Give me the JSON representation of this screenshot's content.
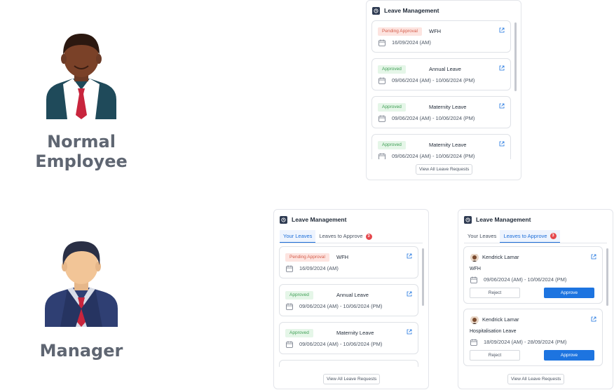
{
  "personas": {
    "employee": {
      "label": "Normal Employee"
    },
    "manager": {
      "label": "Manager"
    }
  },
  "widget_title": "Leave Management",
  "colors": {
    "accent": "#1d74e0",
    "pending_bg": "#fde4e0",
    "approved_bg": "#e5f6e8",
    "badge": "#e5484d"
  },
  "employee_widget": {
    "items": [
      {
        "status": "Pending Approval",
        "status_kind": "pending",
        "type": "WFH",
        "date": "16/09/2024 (AM)"
      },
      {
        "status": "Approved",
        "status_kind": "approved",
        "type": "Annual Leave",
        "date": "09/06/2024 (AM) - 10/06/2024 (PM)"
      },
      {
        "status": "Approved",
        "status_kind": "approved",
        "type": "Maternity Leave",
        "date": "09/06/2024 (AM) - 10/06/2024 (PM)"
      },
      {
        "status": "Approved",
        "status_kind": "approved",
        "type": "Maternity Leave",
        "date": "09/06/2024 (AM) - 10/06/2024 (PM)"
      }
    ],
    "view_all": "View All Leave Requests"
  },
  "manager_widget_your": {
    "tabs": {
      "your_leaves": "Your Leaves",
      "to_approve": "Leaves to Approve",
      "count": "3"
    },
    "items": [
      {
        "status": "Pending Approval",
        "status_kind": "pending",
        "type": "WFH",
        "date": "16/09/2024 (AM)"
      },
      {
        "status": "Approved",
        "status_kind": "approved",
        "type": "Annual Leave",
        "date": "09/06/2024 (AM) - 10/06/2024 (PM)"
      },
      {
        "status": "Approved",
        "status_kind": "approved",
        "type": "Maternity Leave",
        "date": "09/06/2024 (AM) - 10/06/2024 (PM)"
      }
    ],
    "view_all": "View All Leave Requests"
  },
  "manager_widget_approve": {
    "tabs": {
      "your_leaves": "Your Leaves",
      "to_approve": "Leaves to Approve",
      "count": "3"
    },
    "requests": [
      {
        "name": "Kendrick Lamar",
        "type": "WFH",
        "date": "09/06/2024 (AM) - 10/06/2024 (PM)",
        "reject": "Reject",
        "approve": "Approve"
      },
      {
        "name": "Kendrick Lamar",
        "type": "Hospitalisation Leave",
        "date": "18/09/2024 (AM) - 28/09/2024 (PM)",
        "reject": "Reject",
        "approve": "Approve"
      }
    ],
    "view_all": "View All Leave Requests"
  }
}
